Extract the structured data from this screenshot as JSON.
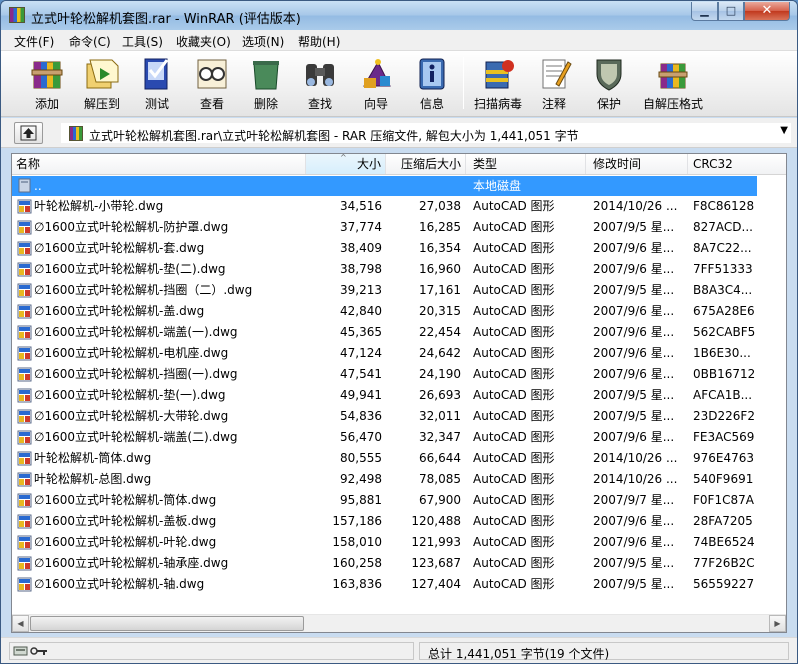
{
  "window": {
    "title": "立式叶轮松解机套图.rar - WinRAR (评估版本)"
  },
  "menu": [
    {
      "label": "文件(F)"
    },
    {
      "label": "命令(C)"
    },
    {
      "label": "工具(S)"
    },
    {
      "label": "收藏夹(O)"
    },
    {
      "label": "选项(N)"
    },
    {
      "label": "帮助(H)"
    }
  ],
  "toolbar": [
    {
      "label": "添加",
      "icon": "add-archive-icon"
    },
    {
      "label": "解压到",
      "icon": "extract-to-icon"
    },
    {
      "label": "测试",
      "icon": "test-icon"
    },
    {
      "label": "查看",
      "icon": "view-icon"
    },
    {
      "label": "删除",
      "icon": "delete-icon"
    },
    {
      "label": "查找",
      "icon": "find-icon"
    },
    {
      "label": "向导",
      "icon": "wizard-icon"
    },
    {
      "label": "信息",
      "icon": "info-icon"
    },
    {
      "label": "扫描病毒",
      "icon": "virus-scan-icon"
    },
    {
      "label": "注释",
      "icon": "comment-icon"
    },
    {
      "label": "保护",
      "icon": "protect-icon"
    },
    {
      "label": "自解压格式",
      "icon": "sfx-icon"
    }
  ],
  "address": {
    "path": "立式叶轮松解机套图.rar\\立式叶轮松解机套图 - RAR 压缩文件, 解包大小为 1,441,051 字节"
  },
  "columns": {
    "name": "名称",
    "size": "大小",
    "packed": "压缩后大小",
    "type": "类型",
    "modified": "修改时间",
    "crc": "CRC32"
  },
  "parent_row": {
    "name": "..",
    "type": "本地磁盘"
  },
  "files": [
    {
      "name": "叶轮松解机-小带轮.dwg",
      "size": "34,516",
      "packed": "27,038",
      "type": "AutoCAD 图形",
      "modified": "2014/10/26 ...",
      "crc": "F8C86128"
    },
    {
      "name": "∅1600立式叶轮松解机-防护罩.dwg",
      "size": "37,774",
      "packed": "16,285",
      "type": "AutoCAD 图形",
      "modified": "2007/9/5 星...",
      "crc": "827ACD..."
    },
    {
      "name": "∅1600立式叶轮松解机-套.dwg",
      "size": "38,409",
      "packed": "16,354",
      "type": "AutoCAD 图形",
      "modified": "2007/9/6 星...",
      "crc": "8A7C22..."
    },
    {
      "name": "∅1600立式叶轮松解机-垫(二).dwg",
      "size": "38,798",
      "packed": "16,960",
      "type": "AutoCAD 图形",
      "modified": "2007/9/6 星...",
      "crc": "7FF51333"
    },
    {
      "name": "∅1600立式叶轮松解机-挡圈（二）.dwg",
      "size": "39,213",
      "packed": "17,161",
      "type": "AutoCAD 图形",
      "modified": "2007/9/5 星...",
      "crc": "B8A3C4..."
    },
    {
      "name": "∅1600立式叶轮松解机-盖.dwg",
      "size": "42,840",
      "packed": "20,315",
      "type": "AutoCAD 图形",
      "modified": "2007/9/6 星...",
      "crc": "675A28E6"
    },
    {
      "name": "∅1600立式叶轮松解机-端盖(一).dwg",
      "size": "45,365",
      "packed": "22,454",
      "type": "AutoCAD 图形",
      "modified": "2007/9/6 星...",
      "crc": "562CABF5"
    },
    {
      "name": "∅1600立式叶轮松解机-电机座.dwg",
      "size": "47,124",
      "packed": "24,642",
      "type": "AutoCAD 图形",
      "modified": "2007/9/6 星...",
      "crc": "1B6E30..."
    },
    {
      "name": "∅1600立式叶轮松解机-挡圈(一).dwg",
      "size": "47,541",
      "packed": "24,190",
      "type": "AutoCAD 图形",
      "modified": "2007/9/6 星...",
      "crc": "0BB16712"
    },
    {
      "name": "∅1600立式叶轮松解机-垫(一).dwg",
      "size": "49,941",
      "packed": "26,693",
      "type": "AutoCAD 图形",
      "modified": "2007/9/5 星...",
      "crc": "AFCA1B..."
    },
    {
      "name": "∅1600立式叶轮松解机-大带轮.dwg",
      "size": "54,836",
      "packed": "32,011",
      "type": "AutoCAD 图形",
      "modified": "2007/9/5 星...",
      "crc": "23D226F2"
    },
    {
      "name": "∅1600立式叶轮松解机-端盖(二).dwg",
      "size": "56,470",
      "packed": "32,347",
      "type": "AutoCAD 图形",
      "modified": "2007/9/6 星...",
      "crc": "FE3AC569"
    },
    {
      "name": "叶轮松解机-筒体.dwg",
      "size": "80,555",
      "packed": "66,644",
      "type": "AutoCAD 图形",
      "modified": "2014/10/26 ...",
      "crc": "976E4763"
    },
    {
      "name": "叶轮松解机-总图.dwg",
      "size": "92,498",
      "packed": "78,085",
      "type": "AutoCAD 图形",
      "modified": "2014/10/26 ...",
      "crc": "540F9691"
    },
    {
      "name": "∅1600立式叶轮松解机-筒体.dwg",
      "size": "95,881",
      "packed": "67,900",
      "type": "AutoCAD 图形",
      "modified": "2007/9/7 星...",
      "crc": "F0F1C87A"
    },
    {
      "name": "∅1600立式叶轮松解机-盖板.dwg",
      "size": "157,186",
      "packed": "120,488",
      "type": "AutoCAD 图形",
      "modified": "2007/9/6 星...",
      "crc": "28FA7205"
    },
    {
      "name": "∅1600立式叶轮松解机-叶轮.dwg",
      "size": "158,010",
      "packed": "121,993",
      "type": "AutoCAD 图形",
      "modified": "2007/9/6 星...",
      "crc": "74BE6524"
    },
    {
      "name": "∅1600立式叶轮松解机-轴承座.dwg",
      "size": "160,258",
      "packed": "123,687",
      "type": "AutoCAD 图形",
      "modified": "2007/9/5 星...",
      "crc": "77F26B2C"
    },
    {
      "name": "∅1600立式叶轮松解机-轴.dwg",
      "size": "163,836",
      "packed": "127,404",
      "type": "AutoCAD 图形",
      "modified": "2007/9/5 星...",
      "crc": "56559227"
    }
  ],
  "status": {
    "total": "总计 1,441,051 字节(19 个文件)"
  },
  "colors": {
    "selection": "#3399ff",
    "title_bar": "#a6c7e8"
  }
}
